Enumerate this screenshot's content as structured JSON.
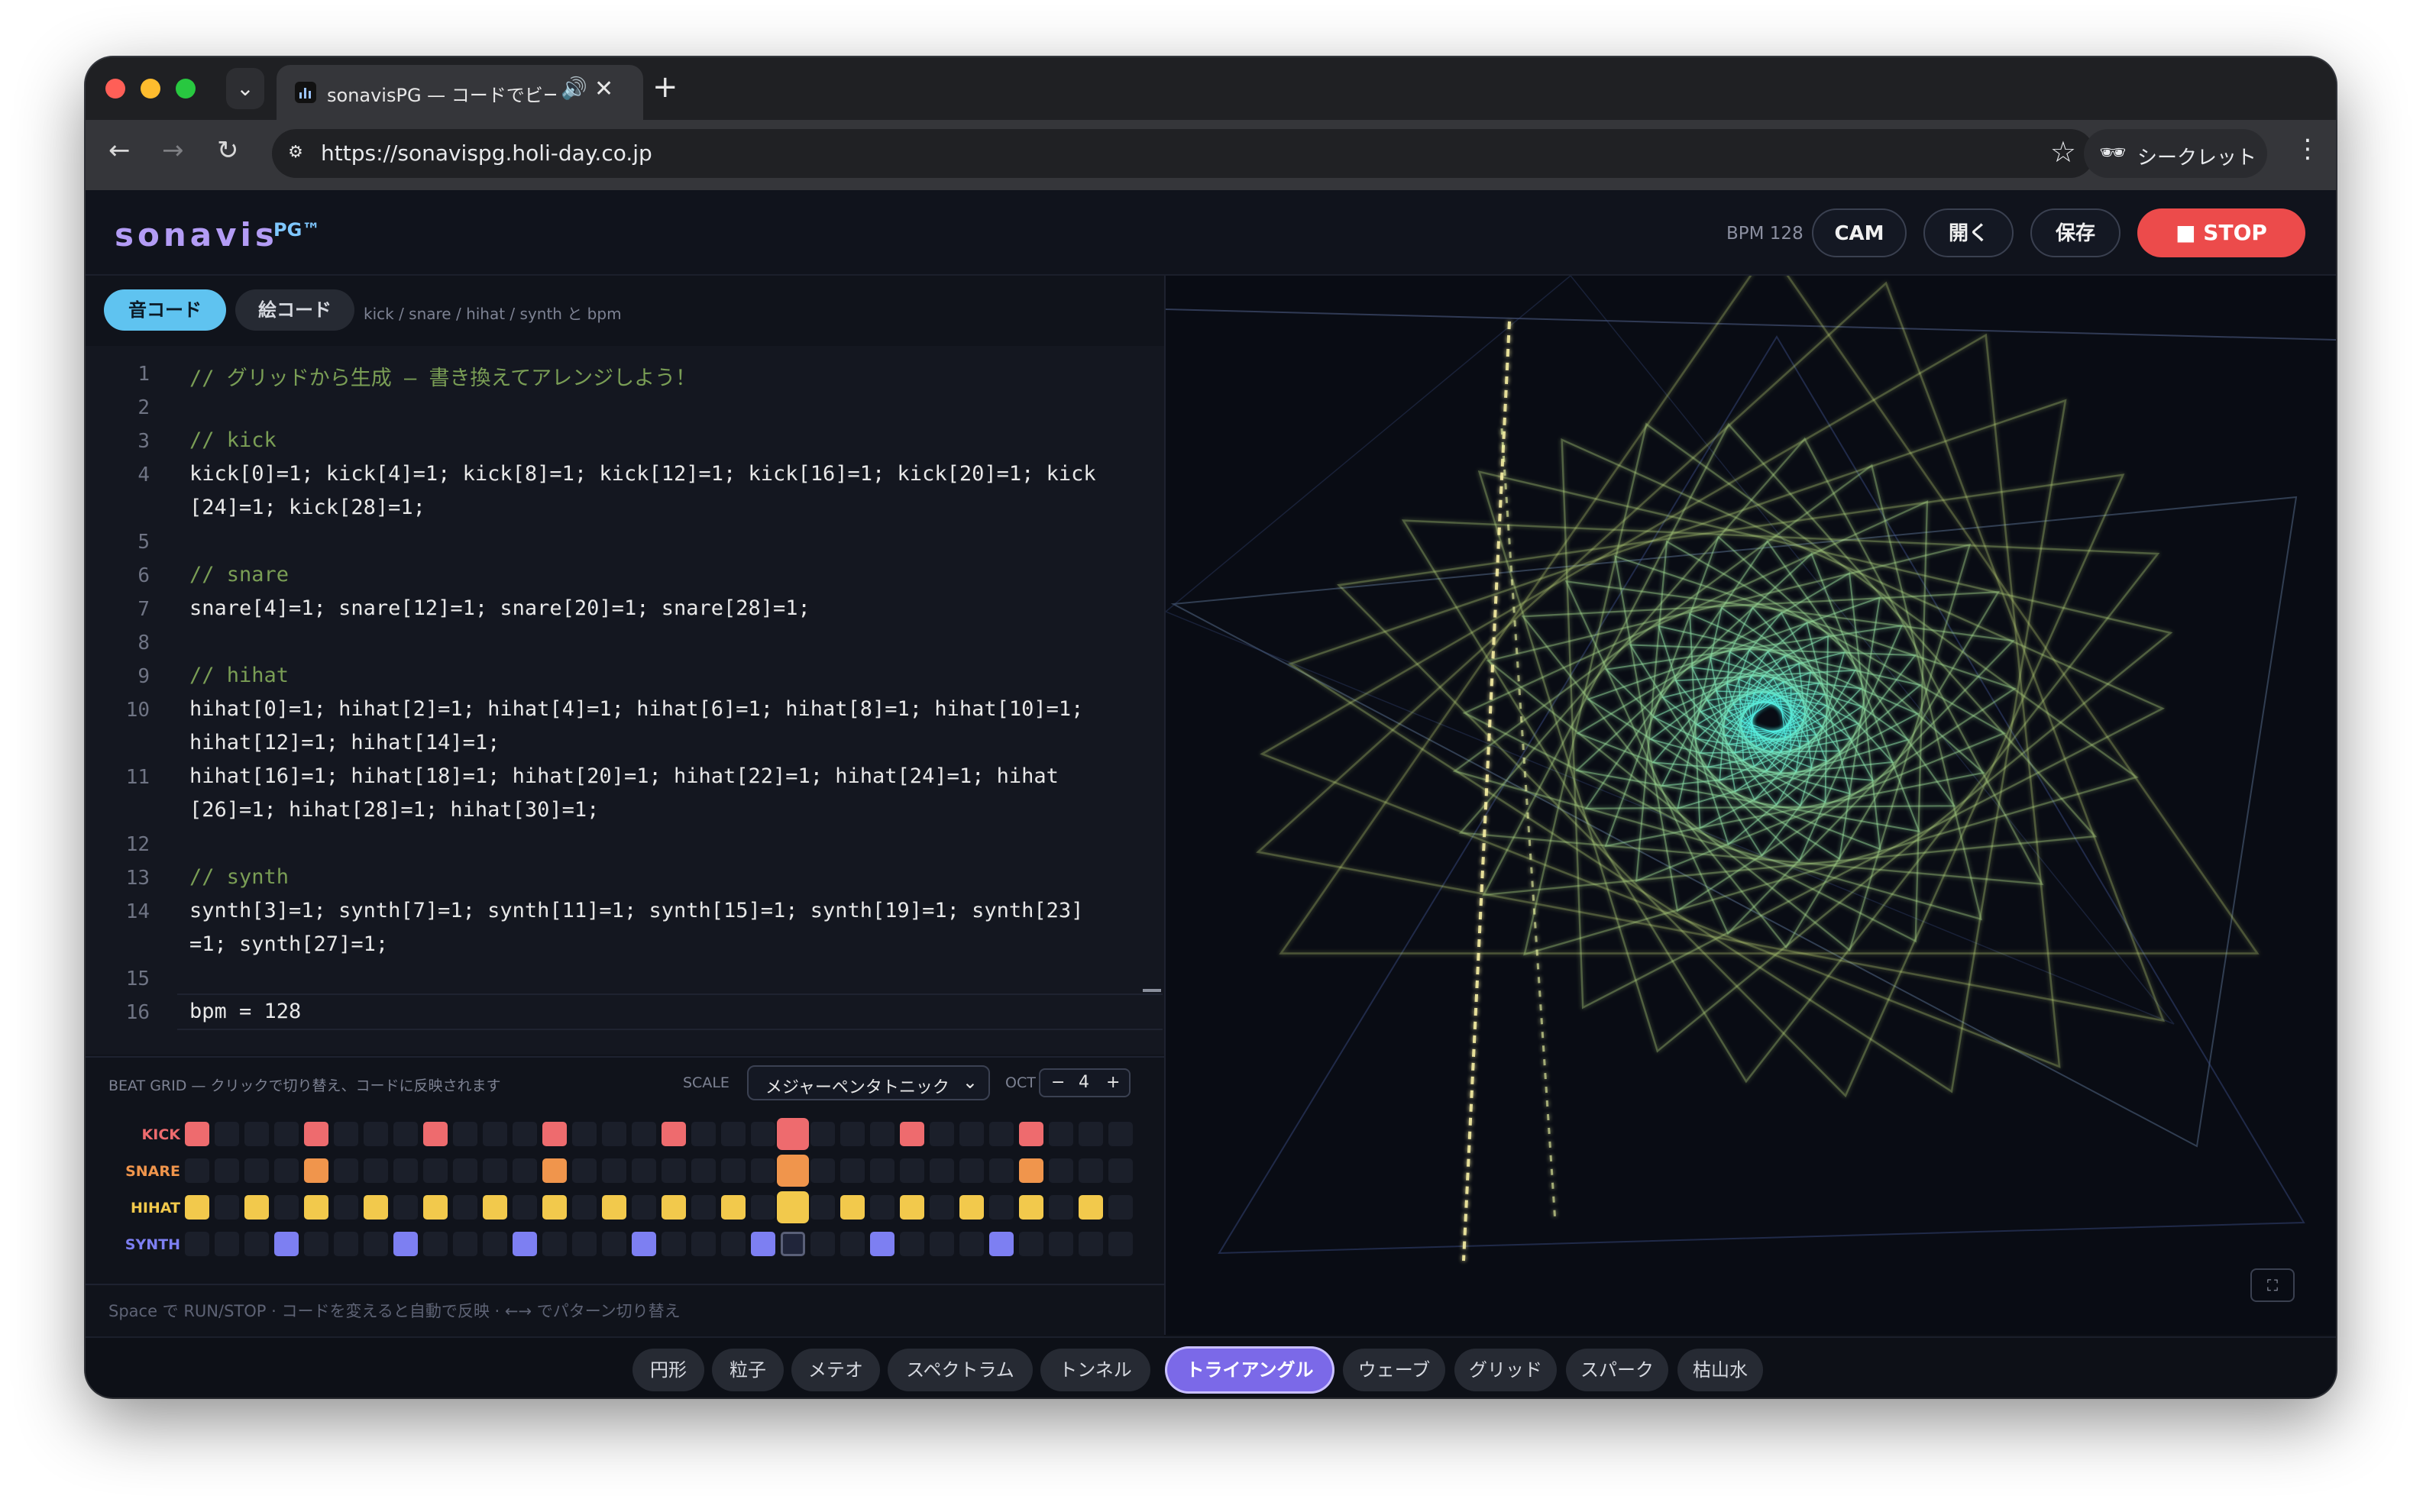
{
  "browser": {
    "tab_title": "sonavisPG — コードでビー",
    "url": "https://sonavispg.holi-day.co.jp",
    "incognito_label": "シークレット",
    "new_tab": "+",
    "tab_close": "✕",
    "tab_audio": "🔊"
  },
  "header": {
    "logo": "sonavis",
    "logo_suffix": "PG™",
    "bpm_label": "BPM 128",
    "cam_label": "CAM",
    "open_label": "開く",
    "save_label": "保存",
    "stop_label": "■ STOP",
    "stop_color": "#ec4b4b"
  },
  "mode_tabs": {
    "sound": "音コード",
    "visual": "絵コード",
    "hint": "kick / snare / hihat / synth と bpm"
  },
  "editor": {
    "lines": [
      {
        "n": "1",
        "text": "// グリッドから生成 — 書き換えてアレンジしよう！",
        "comment": true
      },
      {
        "n": "2",
        "text": ""
      },
      {
        "n": "3",
        "text": "// kick",
        "comment": true
      },
      {
        "n": "4",
        "text": "kick[0]=1; kick[4]=1; kick[8]=1; kick[12]=1; kick[16]=1; kick[20]=1; kick"
      },
      {
        "n": "",
        "text": "[24]=1; kick[28]=1;"
      },
      {
        "n": "5",
        "text": ""
      },
      {
        "n": "6",
        "text": "// snare",
        "comment": true
      },
      {
        "n": "7",
        "text": "snare[4]=1; snare[12]=1; snare[20]=1; snare[28]=1;"
      },
      {
        "n": "8",
        "text": ""
      },
      {
        "n": "9",
        "text": "// hihat",
        "comment": true
      },
      {
        "n": "10",
        "text": "hihat[0]=1; hihat[2]=1; hihat[4]=1; hihat[6]=1; hihat[8]=1; hihat[10]=1;"
      },
      {
        "n": "",
        "text": "hihat[12]=1; hihat[14]=1;"
      },
      {
        "n": "11",
        "text": "hihat[16]=1; hihat[18]=1; hihat[20]=1; hihat[22]=1; hihat[24]=1; hihat"
      },
      {
        "n": "",
        "text": "[26]=1; hihat[28]=1; hihat[30]=1;"
      },
      {
        "n": "12",
        "text": ""
      },
      {
        "n": "13",
        "text": "// synth",
        "comment": true
      },
      {
        "n": "14",
        "text": "synth[3]=1; synth[7]=1; synth[11]=1; synth[15]=1; synth[19]=1; synth[23]"
      },
      {
        "n": "",
        "text": "=1; synth[27]=1;"
      },
      {
        "n": "15",
        "text": ""
      },
      {
        "n": "16",
        "text": "bpm = 128"
      }
    ]
  },
  "beat_grid": {
    "label": "BEAT GRID — クリックで切り替え、コードに反映されます",
    "scale_label": "SCALE",
    "scale_value": "メジャーペンタトニック",
    "oct_label": "OCT",
    "oct_minus": "−",
    "oct_value": "4",
    "oct_plus": "+",
    "steps": 32,
    "playhead_step": 20,
    "cursor": {
      "row": 3,
      "step": 20
    },
    "rows": [
      {
        "name": "KICK",
        "color": "#ee6b6e",
        "active": [
          0,
          4,
          8,
          12,
          16,
          20,
          24,
          28
        ]
      },
      {
        "name": "SNARE",
        "color": "#f0954c",
        "active": [
          4,
          12,
          20,
          28
        ]
      },
      {
        "name": "HIHAT",
        "color": "#f2c94c",
        "active": [
          0,
          2,
          4,
          6,
          8,
          10,
          12,
          14,
          16,
          18,
          20,
          22,
          24,
          26,
          28,
          30
        ]
      },
      {
        "name": "SYNTH",
        "color": "#7d7ff2",
        "active": [
          3,
          7,
          11,
          15,
          19,
          23,
          27
        ]
      }
    ],
    "help": "Space で RUN/STOP · コードを変えると自動で反映 · ←→ でパターン切り替え"
  },
  "visual": {
    "mode": "triangle",
    "fullscreen_icon": "⛶"
  },
  "bottom_tabs": [
    {
      "label": "円形"
    },
    {
      "label": "粒子"
    },
    {
      "label": "メテオ"
    },
    {
      "label": "スペクトラム"
    },
    {
      "label": "トンネル"
    },
    {
      "label": "トライアングル",
      "active": true
    },
    {
      "label": "ウェーブ"
    },
    {
      "label": "グリッド"
    },
    {
      "label": "スパーク"
    },
    {
      "label": "枯山水"
    }
  ]
}
